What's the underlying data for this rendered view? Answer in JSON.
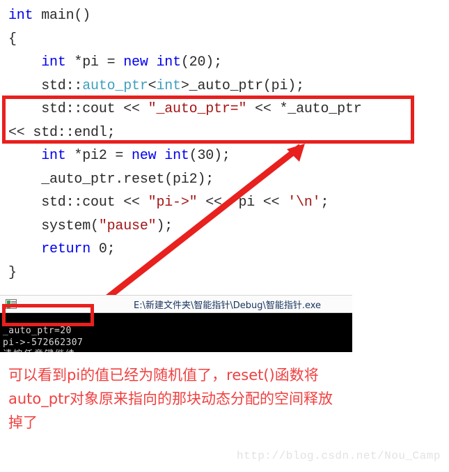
{
  "code": {
    "language": "cpp",
    "lines": [
      [
        {
          "t": "int",
          "c": "kw"
        },
        {
          "t": " main()",
          "c": "pln"
        }
      ],
      [
        {
          "t": "{",
          "c": "pln"
        }
      ],
      [
        {
          "t": "    ",
          "c": "pln"
        },
        {
          "t": "int",
          "c": "kw"
        },
        {
          "t": " *pi = ",
          "c": "pln"
        },
        {
          "t": "new",
          "c": "kw"
        },
        {
          "t": " ",
          "c": "pln"
        },
        {
          "t": "int",
          "c": "kw"
        },
        {
          "t": "(20);",
          "c": "pln"
        }
      ],
      [
        {
          "t": "    std::",
          "c": "pln"
        },
        {
          "t": "auto_ptr",
          "c": "typ"
        },
        {
          "t": "<",
          "c": "pln"
        },
        {
          "t": "int",
          "c": "typ"
        },
        {
          "t": ">_auto_ptr(pi);",
          "c": "pln"
        }
      ],
      [
        {
          "t": "    std::cout << ",
          "c": "pln"
        },
        {
          "t": "\"_auto_ptr=\"",
          "c": "str"
        },
        {
          "t": " << *_auto_ptr",
          "c": "pln"
        }
      ],
      [
        {
          "t": "<< std::endl;",
          "c": "pln"
        }
      ],
      [
        {
          "t": "    ",
          "c": "pln"
        },
        {
          "t": "int",
          "c": "kw"
        },
        {
          "t": " *pi2 = ",
          "c": "pln"
        },
        {
          "t": "new",
          "c": "kw"
        },
        {
          "t": " ",
          "c": "pln"
        },
        {
          "t": "int",
          "c": "kw"
        },
        {
          "t": "(30);",
          "c": "pln"
        }
      ],
      [
        {
          "t": "    _auto_ptr.reset(pi2);",
          "c": "pln"
        }
      ],
      [
        {
          "t": "    std::cout << ",
          "c": "pln"
        },
        {
          "t": "\"pi->\"",
          "c": "str"
        },
        {
          "t": " << *pi << ",
          "c": "pln"
        },
        {
          "t": "'\\n'",
          "c": "str"
        },
        {
          "t": ";",
          "c": "pln"
        }
      ],
      [
        {
          "t": "    system(",
          "c": "pln"
        },
        {
          "t": "\"pause\"",
          "c": "str"
        },
        {
          "t": ");",
          "c": "pln"
        }
      ],
      [
        {
          "t": "    ",
          "c": "pln"
        },
        {
          "t": "return",
          "c": "kw"
        },
        {
          "t": " 0;",
          "c": "pln"
        }
      ],
      [
        {
          "t": "}",
          "c": "pln"
        }
      ]
    ]
  },
  "highlight": {
    "code_box_color": "#e8201e",
    "console_box_color": "#e8201e",
    "arrow_color": "#e8201e"
  },
  "console": {
    "icon_name": "console-window-icon",
    "title": "E:\\新建文件夹\\智能指针\\Debug\\智能指针.exe",
    "output_lines": [
      "",
      "_auto_ptr=20",
      "pi->-572662307",
      "请按任意键继续. . ."
    ],
    "background": "#000000",
    "text_color": "#d8d8d8"
  },
  "annotation": {
    "color": "#f04040",
    "lines": [
      "可以看到pi的值已经为随机值了，reset()函数将",
      "auto_ptr对象原来指向的那块动态分配的空间释放",
      "掉了"
    ]
  },
  "watermark": {
    "text": "http://blog.csdn.net/Nou_Camp",
    "color": "#e2e2e2"
  }
}
